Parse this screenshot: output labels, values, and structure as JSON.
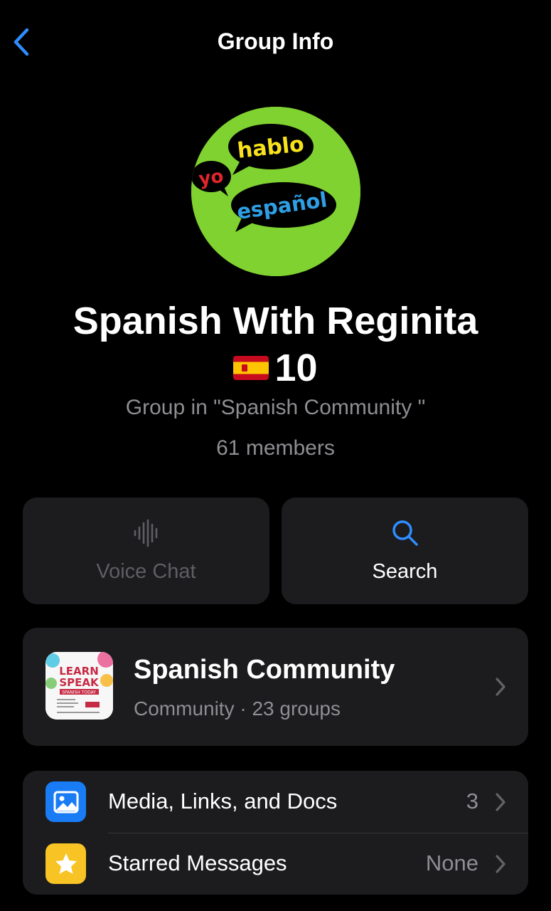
{
  "nav": {
    "title": "Group Info"
  },
  "avatar": {
    "words": {
      "yo": "yo",
      "hablo": "hablo",
      "espanol": "español"
    }
  },
  "group": {
    "name_line1": "Spanish With Reginita",
    "name_line2": "10",
    "subtitle": "Group in \"Spanish Community \"",
    "members": "61 members"
  },
  "actions": {
    "voice_chat": {
      "label": "Voice Chat",
      "icon": "waveform-icon",
      "enabled": false
    },
    "search": {
      "label": "Search",
      "icon": "search-icon"
    }
  },
  "community": {
    "name": "Spanish Community",
    "subtitle": "Community · 23 groups",
    "thumb": {
      "line1": "LEARN",
      "line2": "SPEAK",
      "line3": "SPANISH TODAY"
    }
  },
  "list": [
    {
      "label": "Media, Links, and Docs",
      "value": "3",
      "icon": "photo-icon",
      "color": "#1a7cf5"
    },
    {
      "label": "Starred Messages",
      "value": "None",
      "icon": "star-icon",
      "color": "#f7c325"
    }
  ],
  "colors": {
    "accent": "#2f8dff",
    "background": "#000000",
    "card": "#1c1c1e"
  }
}
